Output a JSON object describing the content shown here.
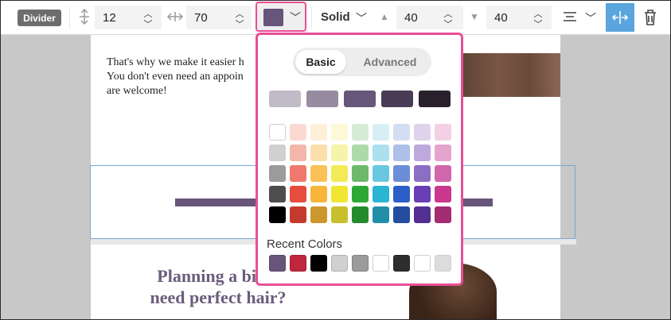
{
  "toolbar": {
    "badge": "Divider",
    "height_value": "12",
    "width_value": "70",
    "selected_color": "#67557a",
    "line_style": "Solid",
    "padding_top": "40",
    "padding_bottom": "40",
    "icons": [
      "vertical-resize-icon",
      "horizontal-resize-icon",
      "chevron-down-icon",
      "triangle-up-icon",
      "triangle-down-icon",
      "align-icon",
      "full-width-icon",
      "trash-icon"
    ]
  },
  "page": {
    "body_text": "That's why we make it easier h\nYou don't even need an appoin\nare welcome!",
    "heading": "Planning a big d\nneed perfect hair?",
    "divider_color": "#67557a"
  },
  "color_picker": {
    "tabs": [
      "Basic",
      "Advanced"
    ],
    "active_tab": "Basic",
    "shades": [
      "#c1bbc8",
      "#978ba0",
      "#67557a",
      "#4a3c56",
      "#29222d"
    ],
    "palette": [
      [
        "#ffffff",
        "#fbd9d3",
        "#feefd6",
        "#fcf8d8",
        "#d6ebd5",
        "#d7eef5",
        "#d5ddf2",
        "#ddd3ec",
        "#f3d0e6"
      ],
      [
        "#d0d0d0",
        "#f4b6ab",
        "#fce0aa",
        "#f8f3aa",
        "#acdba9",
        "#ade0ef",
        "#aebfe9",
        "#bfa8dc",
        "#e5a3cd"
      ],
      [
        "#9b9b9b",
        "#ef796c",
        "#f9c156",
        "#f2ea57",
        "#6cb96b",
        "#6ac7e0",
        "#6c8ed6",
        "#8d6ec5",
        "#d266ac"
      ],
      [
        "#4d4d4d",
        "#e84c3d",
        "#f7b53a",
        "#f0e633",
        "#2ea835",
        "#2bb4d4",
        "#2c5ec8",
        "#6a3eb7",
        "#c9378f"
      ],
      [
        "#000000",
        "#c43b2e",
        "#cb972e",
        "#c8bf2e",
        "#258a2b",
        "#228fa8",
        "#244c9f",
        "#532f92",
        "#a32c73"
      ]
    ],
    "recent_label": "Recent Colors",
    "recent": [
      "#67557a",
      "#c0263d",
      "#000000",
      "#d0d0d0",
      "#9b9b9b",
      "#ffffff",
      "#2d2d2d",
      "#ffffff",
      "#dcdcdc"
    ]
  }
}
